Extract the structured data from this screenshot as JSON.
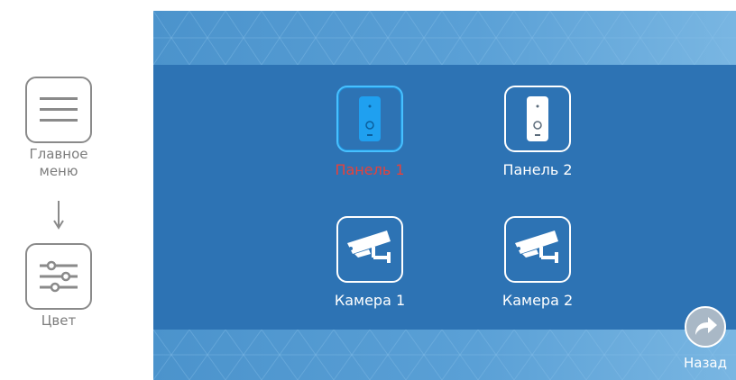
{
  "left_guide": {
    "step1_label": "Главное\nменю",
    "step1_icon": "hamburger-menu-icon",
    "step2_label": "Цвет",
    "step2_icon": "sliders-icon"
  },
  "screen": {
    "tiles": [
      {
        "label": "Панель 1",
        "icon": "door-panel-icon",
        "selected": true
      },
      {
        "label": "Панель 2",
        "icon": "door-panel-icon",
        "selected": false
      },
      {
        "label": "Камера 1",
        "icon": "cctv-camera-icon",
        "selected": false
      },
      {
        "label": "Камера 2",
        "icon": "cctv-camera-icon",
        "selected": false
      }
    ],
    "back_label": "Назад",
    "back_icon": "curved-arrow-right-icon"
  },
  "colors": {
    "screen_blue": "#2d73b4",
    "band_blue": "#5aa0d6",
    "selected_outline": "#47c0ff",
    "selected_label": "#e8413a",
    "guide_gray": "#8a8a8a"
  }
}
